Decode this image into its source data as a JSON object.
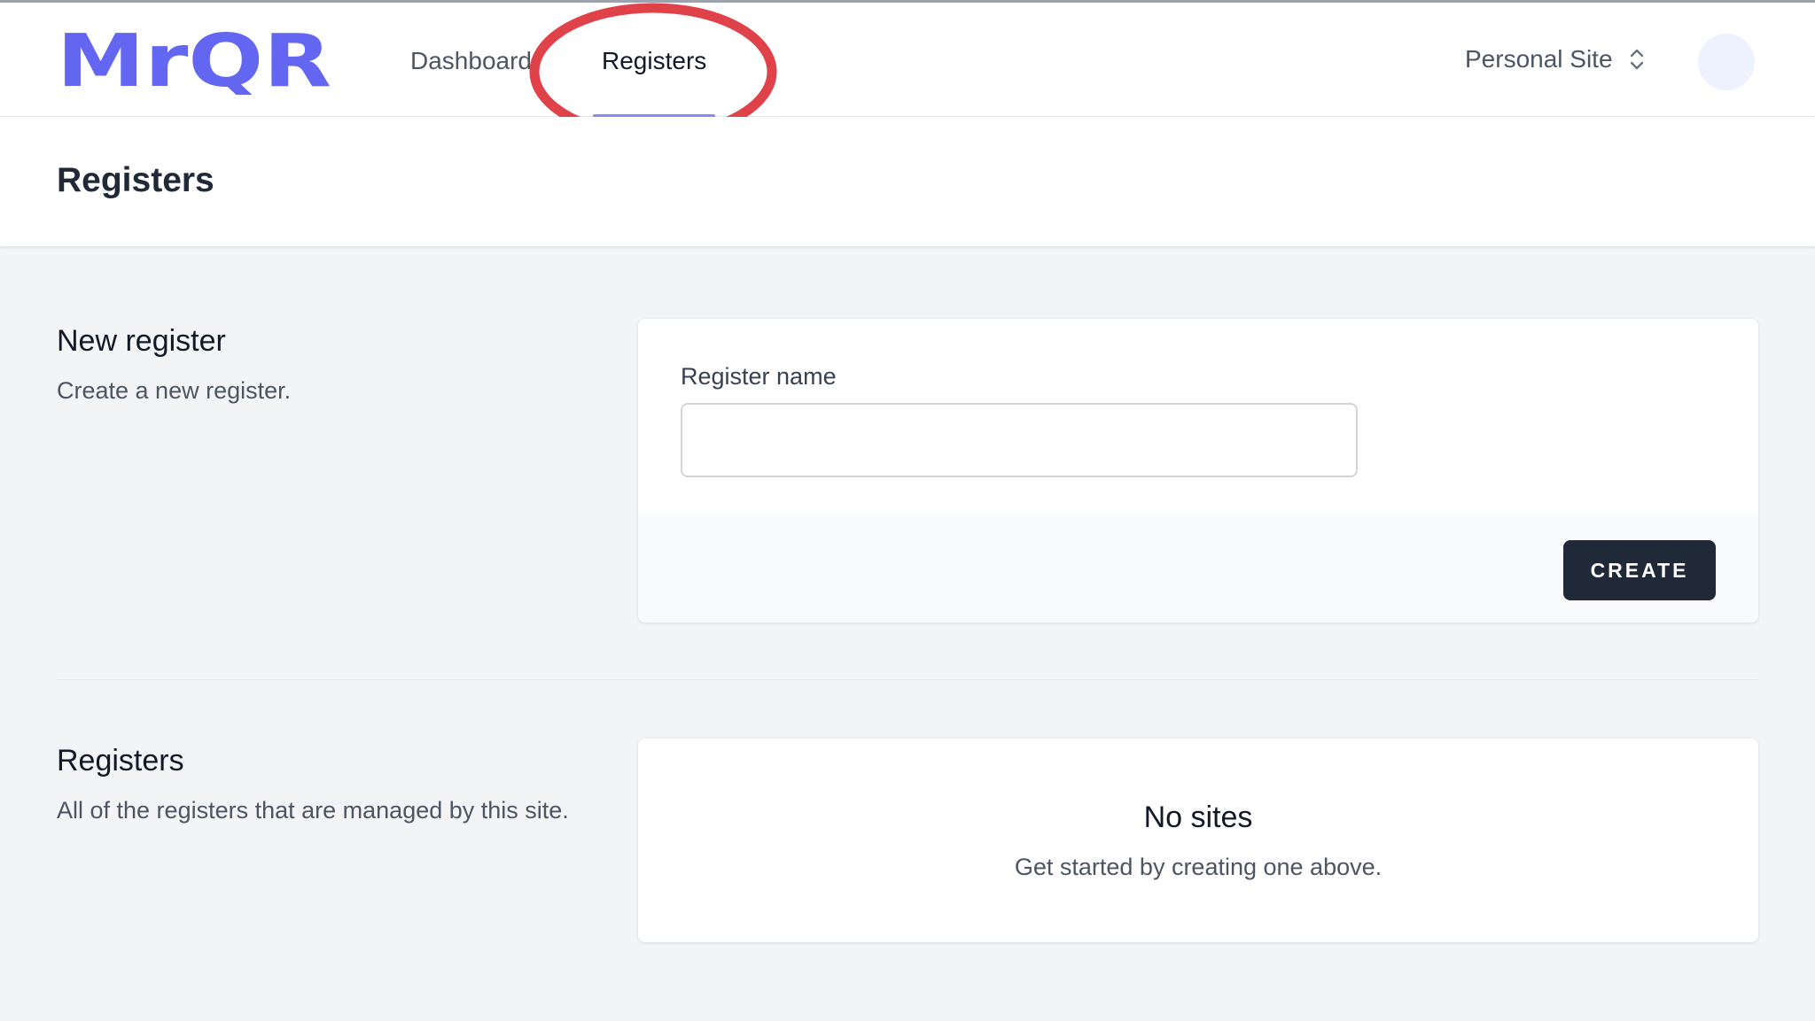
{
  "brand": {
    "logo_text": "MrQR",
    "color": "#6366f1"
  },
  "nav": {
    "links": [
      {
        "label": "Dashboard"
      },
      {
        "label": "Registers",
        "active": true
      }
    ],
    "active_underline_color": "#818cf8",
    "annotation_color": "#e0424a"
  },
  "site_switcher": {
    "label": "Personal Site",
    "icon": "chevron-up-down-icon"
  },
  "user": {
    "avatar_icon": "avatar"
  },
  "page": {
    "title": "Registers"
  },
  "new_register": {
    "title": "New register",
    "description": "Create a new register.",
    "field_label": "Register name",
    "field_value": "",
    "button_label": "CREATE"
  },
  "registers": {
    "title": "Registers",
    "description": "All of the registers that are managed by this site.",
    "empty_title": "No sites",
    "empty_description": "Get started by creating one above."
  }
}
